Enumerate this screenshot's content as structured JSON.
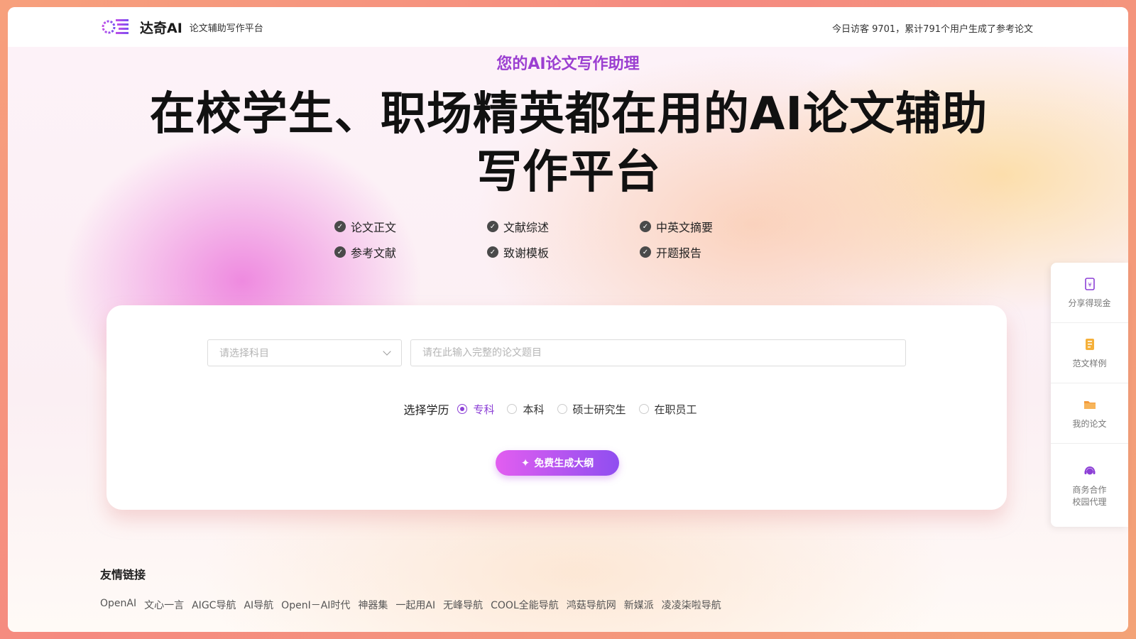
{
  "header": {
    "brand_name": "达奇AI",
    "brand_subtitle": "论文辅助写作平台",
    "visitors_text": "今日访客 9701，累计791个用户生成了参考论文"
  },
  "hero": {
    "tagline": "您的AI论文写作助理",
    "headline_line1": "在校学生、职场精英都在用的AI论文辅助",
    "headline_line2": "写作平台",
    "features": [
      "论文正文",
      "文献综述",
      "中英文摘要",
      "参考文献",
      "致谢模板",
      "开题报告"
    ]
  },
  "form": {
    "subject_placeholder": "请选择科目",
    "title_placeholder": "请在此输入完整的论文题目",
    "education_label": "选择学历",
    "education_options": [
      "专科",
      "本科",
      "硕士研究生",
      "在职员工"
    ],
    "education_selected": "专科",
    "generate_label": "免费生成大纲"
  },
  "friend_links": {
    "title": "友情链接",
    "items": [
      "OpenAI",
      "文心一言",
      "AIGC导航",
      "AI导航",
      "OpenI－AI时代",
      "神器集",
      "一起用AI",
      "无峰导航",
      "COOL全能导航",
      "鸿菇导航网",
      "新媒派",
      "凌凌柒啦导航"
    ]
  },
  "side_panel": {
    "items": [
      {
        "label": "分享得现金",
        "icon": "share-cash-icon"
      },
      {
        "label": "范文样例",
        "icon": "document-icon"
      },
      {
        "label": "我的论文",
        "icon": "folder-icon"
      },
      {
        "label_line1": "商务合作",
        "label_line2": "校园代理",
        "icon": "customer-service-icon"
      }
    ]
  },
  "colors": {
    "accent": "#8c3fd6",
    "tagline": "#9b3fd1",
    "button_gradient_start": "#e25ef0",
    "button_gradient_end": "#8f4ef0"
  }
}
